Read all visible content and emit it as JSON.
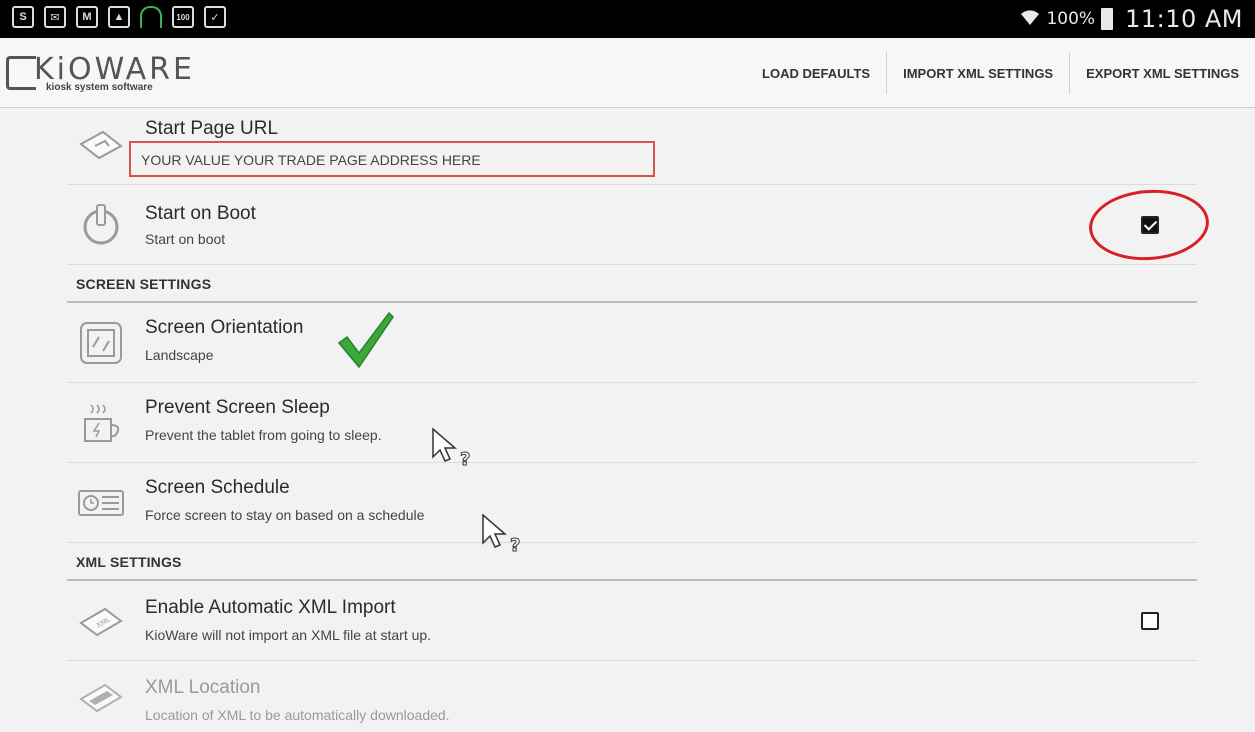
{
  "status_bar": {
    "battery_pct": "100%",
    "time": "11:10 AM",
    "left_icons": [
      "skype-icon",
      "email-icon",
      "gmail-icon",
      "gallery-icon",
      "headset-icon",
      "battery-widget-icon",
      "clipboard-check-icon"
    ]
  },
  "app": {
    "logo_word": "KiOWARE",
    "logo_tagline": "kiosk system software"
  },
  "toolbar": {
    "load_defaults": "LOAD DEFAULTS",
    "import_xml": "IMPORT XML SETTINGS",
    "export_xml": "EXPORT XML SETTINGS"
  },
  "settings": {
    "start_page": {
      "title": "Start Page URL",
      "value": "YOUR VALUE YOUR TRADE PAGE ADDRESS HERE"
    },
    "start_on_boot": {
      "title": "Start on Boot",
      "sub": "Start on boot",
      "checked": true
    },
    "screen_section": "SCREEN SETTINGS",
    "screen_orientation": {
      "title": "Screen Orientation",
      "sub": "Landscape"
    },
    "prevent_sleep": {
      "title": "Prevent Screen Sleep",
      "sub": "Prevent the tablet from going to sleep."
    },
    "screen_schedule": {
      "title": "Screen Schedule",
      "sub": "Force screen to stay on based on a schedule"
    },
    "xml_section": "XML SETTINGS",
    "auto_xml_import": {
      "title": "Enable Automatic XML Import",
      "sub": "KioWare will not import an XML file at start up.",
      "checked": false
    },
    "xml_location": {
      "title": "XML Location",
      "sub": "Location of XML to be automatically downloaded."
    }
  },
  "colors": {
    "highlight_red": "#d82020",
    "check_green": "#3aa83a"
  }
}
